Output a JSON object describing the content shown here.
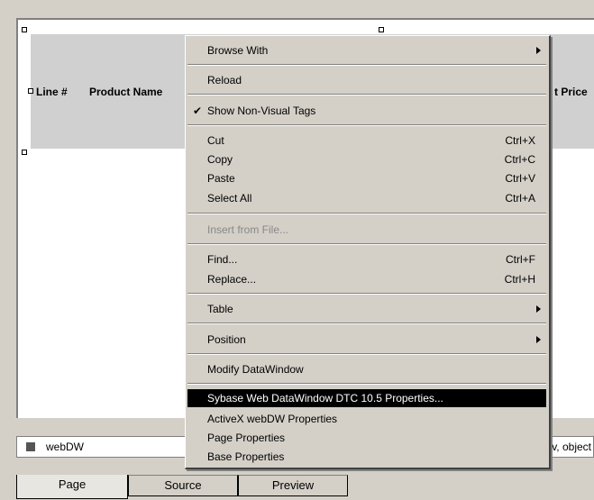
{
  "table_headers": {
    "line": "Line #",
    "product": "Product Name",
    "price": "t Price"
  },
  "object_bar": {
    "name": "webDW",
    "right_text": "v, object"
  },
  "tabs": [
    "Page",
    "Source",
    "Preview"
  ],
  "menu": {
    "browse_with": "Browse With",
    "reload": "Reload",
    "show_nonvisual": "Show Non-Visual Tags",
    "check_mark": "✔",
    "cut": "Cut",
    "cut_sc": "Ctrl+X",
    "copy": "Copy",
    "copy_sc": "Ctrl+C",
    "paste": "Paste",
    "paste_sc": "Ctrl+V",
    "select_all": "Select All",
    "select_all_sc": "Ctrl+A",
    "insert_from_file": "Insert from File...",
    "find": "Find...",
    "find_sc": "Ctrl+F",
    "replace": "Replace...",
    "replace_sc": "Ctrl+H",
    "table": "Table",
    "position": "Position",
    "modify_datawindow": "Modify DataWindow",
    "sybase_props": "Sybase Web DataWindow DTC 10.5 Properties...",
    "activex_props": "ActiveX webDW Properties",
    "page_props": "Page Properties",
    "base_props": "Base Properties"
  }
}
